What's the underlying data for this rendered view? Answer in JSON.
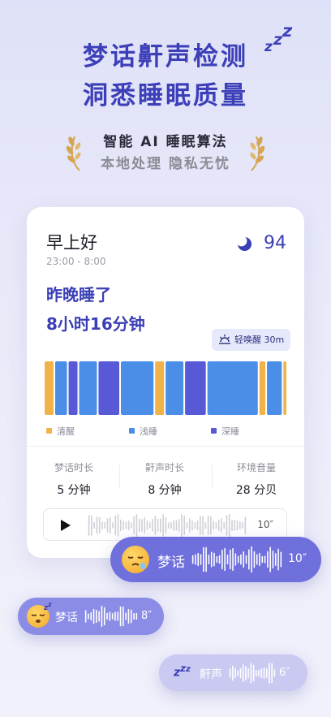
{
  "header": {
    "line1": "梦话鼾声检测",
    "line2": "洞悉睡眠质量",
    "sub1": "智能 AI 睡眠算法",
    "sub2": "本地处理 隐私无忧",
    "zz_icon": "sleep-zzz-icon"
  },
  "card": {
    "greeting": "早上好",
    "time_range": "23:00 - 8:00",
    "score": "94",
    "slept_label": "昨晚睡了",
    "slept_value": "8小时16分钟",
    "smart_wake": "轻唤醒 30m",
    "legend": [
      {
        "label": "清醒",
        "color": "#f1b24a"
      },
      {
        "label": "浅睡",
        "color": "#4a8ee8"
      },
      {
        "label": "深睡",
        "color": "#5759d6"
      }
    ],
    "segments": [
      {
        "stage": "awake",
        "w": 3
      },
      {
        "stage": "light",
        "w": 4
      },
      {
        "stage": "deep",
        "w": 3
      },
      {
        "stage": "light",
        "w": 6
      },
      {
        "stage": "deep",
        "w": 7
      },
      {
        "stage": "light",
        "w": 11
      },
      {
        "stage": "awake",
        "w": 3
      },
      {
        "stage": "light",
        "w": 6
      },
      {
        "stage": "deep",
        "w": 7
      },
      {
        "stage": "light",
        "w": 17
      },
      {
        "stage": "awake",
        "w": 2
      },
      {
        "stage": "light",
        "w": 5
      },
      {
        "stage": "awake",
        "w": 1
      }
    ],
    "stats": [
      {
        "label": "梦话时长",
        "value": "5 分钟"
      },
      {
        "label": "鼾声时长",
        "value": "8 分钟"
      },
      {
        "label": "环境音量",
        "value": "28 分贝"
      }
    ],
    "player": {
      "duration": "10″"
    }
  },
  "bubbles": [
    {
      "label": "梦话",
      "duration": "10″",
      "icon": "sleepy-face-emoji"
    },
    {
      "label": "梦话",
      "duration": "8″",
      "icon": "sleeping-face-emoji"
    },
    {
      "label": "鼾声",
      "duration": "6″",
      "icon": "zzz-icon"
    }
  ],
  "colors": {
    "brand": "#3b3fb5",
    "awake": "#f1b24a",
    "light": "#4a8ee8",
    "deep": "#5759d6"
  }
}
